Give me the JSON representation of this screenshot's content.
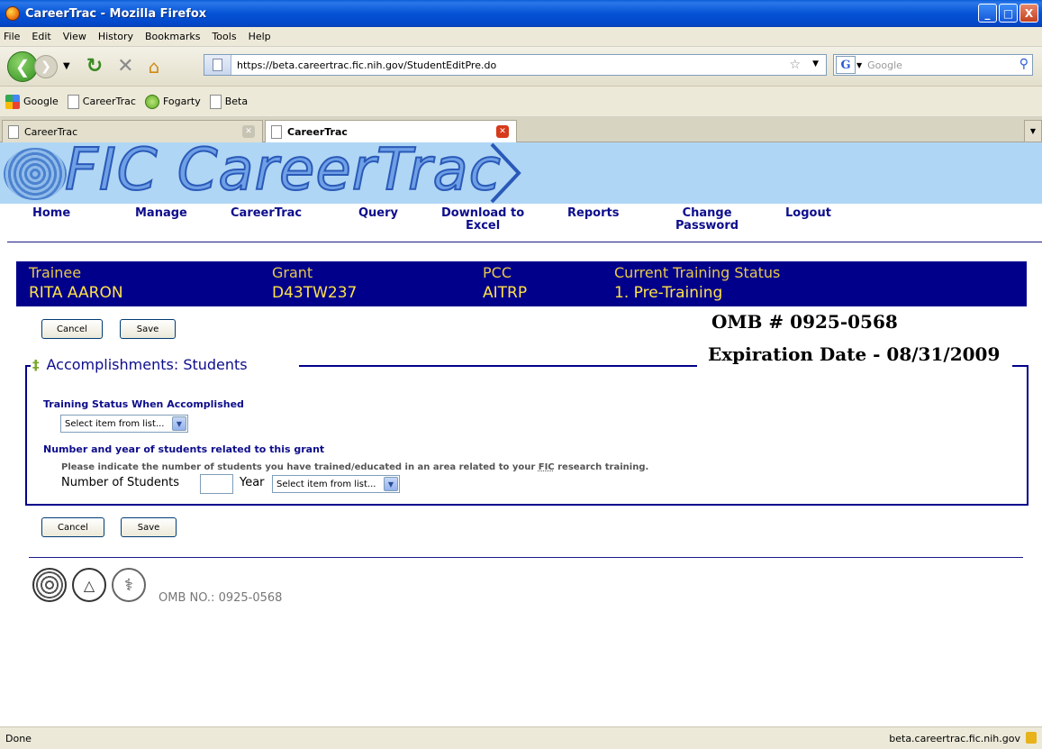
{
  "window": {
    "title": "CareerTrac - Mozilla Firefox",
    "controls": [
      "_",
      "□",
      "X"
    ]
  },
  "menu": [
    "File",
    "Edit",
    "View",
    "History",
    "Bookmarks",
    "Tools",
    "Help"
  ],
  "navbar": {
    "url": "https://beta.careertrac.fic.nih.gov/StudentEditPre.do",
    "search_placeholder": "Google",
    "search_engine_glyph": "G"
  },
  "bookmarks": [
    {
      "label": "Google",
      "icon": "google-icon"
    },
    {
      "label": "CareerTrac",
      "icon": "page-icon"
    },
    {
      "label": "Fogarty",
      "icon": "fogarty-icon"
    },
    {
      "label": "Beta",
      "icon": "page-icon"
    }
  ],
  "tabs": [
    {
      "label": "CareerTrac",
      "active": false
    },
    {
      "label": "CareerTrac",
      "active": true
    }
  ],
  "banner": {
    "brand": "FIC CareerTrac"
  },
  "mainnav": [
    {
      "label": "Home"
    },
    {
      "label": "Manage"
    },
    {
      "label": "CareerTrac"
    },
    {
      "label": "Query"
    },
    {
      "label": "Download to\nExcel"
    },
    {
      "label": "Reports"
    },
    {
      "label": "Change\nPassword"
    },
    {
      "label": "Logout"
    }
  ],
  "info": {
    "trainee_label": "Trainee",
    "trainee_value": "RITA AARON",
    "grant_label": "Grant",
    "grant_value": "D43TW237",
    "pcc_label": "PCC",
    "pcc_value": "AITRP",
    "status_label": "Current Training Status",
    "status_value": "1. Pre-Training"
  },
  "buttons": {
    "cancel": "Cancel",
    "save": "Save"
  },
  "omb": {
    "number": "OMB # 0925-0568",
    "expiration": "Expiration Date - 08/31/2009"
  },
  "section": {
    "title": "Accomplishments: Students",
    "training_status_label": "Training Status When Accomplished",
    "training_status_select": "Select item from list...",
    "students_label": "Number and year of students related to this grant",
    "note_pre": "Please indicate the number of students you have trained/educated in an area related to your ",
    "note_abbr": "FIC",
    "note_post": " research training.",
    "number_label": "Number of Students",
    "number_value": "",
    "year_label": "Year",
    "year_select": "Select item from list..."
  },
  "footer": {
    "omb": "OMB NO.: 0925-0568"
  },
  "status": {
    "text": "Done",
    "host": "beta.careertrac.fic.nih.gov"
  },
  "colors": {
    "navy": "#00008b",
    "gold": "#ffd24d",
    "banner": "#b0d6f5"
  }
}
